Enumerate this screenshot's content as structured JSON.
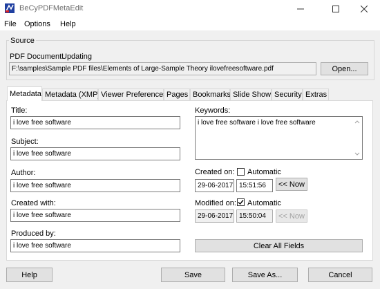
{
  "window": {
    "title": "BeCyPDFMetaEdit",
    "controls": [
      "minimize-icon",
      "maximize-icon",
      "close-icon"
    ]
  },
  "menu": {
    "items": [
      "File",
      "Options",
      "Help"
    ]
  },
  "source": {
    "legend": "Source",
    "pdf_label": "PDF Document:",
    "status": "Updating",
    "path": "F:\\samples\\Sample PDF files\\Elements of Large-Sample Theory ilovefreesoftware.pdf",
    "open_label": "Open..."
  },
  "tabs": [
    "Metadata",
    "Metadata (XMP)",
    "Viewer Preferences",
    "Pages",
    "Bookmarks",
    "Slide Show",
    "Security",
    "Extras"
  ],
  "active_tab": "Metadata",
  "metadata": {
    "title_label": "Title:",
    "title_value": "i love free software",
    "subject_label": "Subject:",
    "subject_value": "i love free software",
    "author_label": "Author:",
    "author_value": "i love free software",
    "created_with_label": "Created with:",
    "created_with_value": "i love free software",
    "produced_by_label": "Produced by:",
    "produced_by_value": "i love free software",
    "keywords_label": "Keywords:",
    "keywords_value": "i love free software i love free software",
    "created_on_label": "Created on:",
    "created_automatic_label": "Automatic",
    "created_automatic_checked": false,
    "created_date": "29-06-2017",
    "created_time": "15:51:56",
    "created_now_label": "<< Now",
    "modified_on_label": "Modified on:",
    "modified_automatic_label": "Automatic",
    "modified_automatic_checked": true,
    "modified_date": "29-06-2017",
    "modified_time": "15:50:04",
    "modified_now_label": "<< Now",
    "clear_all_label": "Clear All Fields"
  },
  "footer": {
    "help_label": "Help",
    "save_label": "Save",
    "save_as_label": "Save As...",
    "cancel_label": "Cancel"
  }
}
